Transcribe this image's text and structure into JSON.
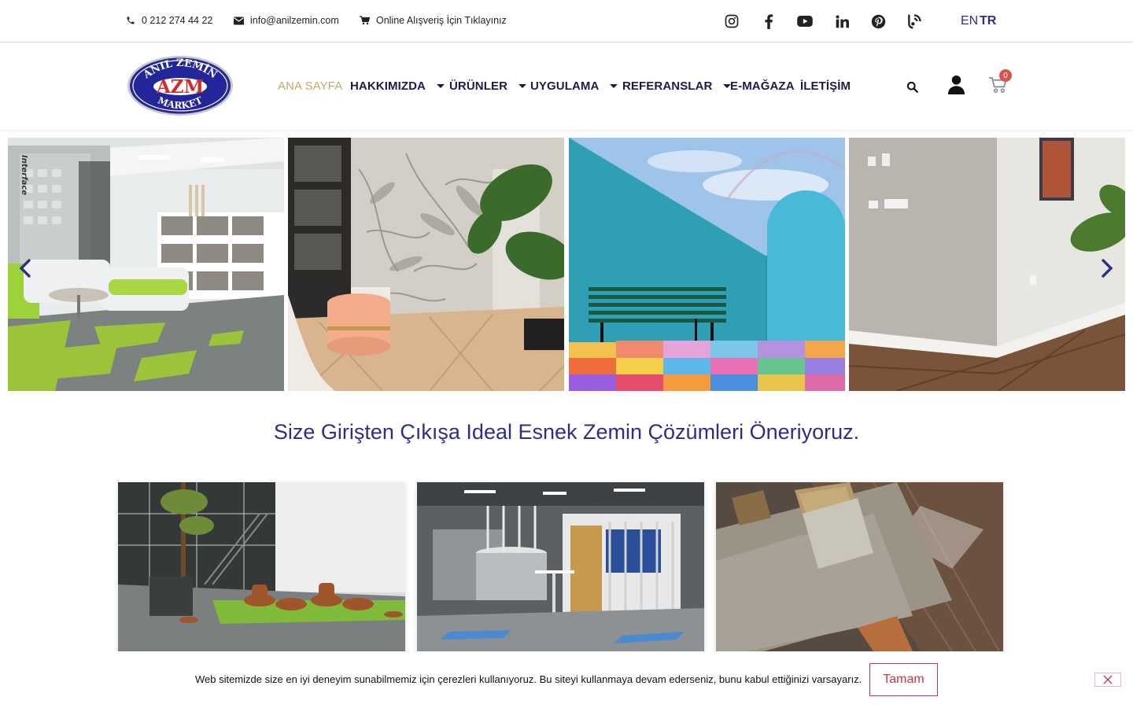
{
  "topbar": {
    "phone": "0 212 274 44 22",
    "email": "info@anilzemin.com",
    "shop": "Online Alışveriş İçin Tıklayınız",
    "social_icons": [
      "instagram-icon",
      "facebook-icon",
      "youtube-icon",
      "linkedin-icon",
      "pinterest-icon",
      "blog-icon"
    ],
    "lang_en": "EN",
    "lang_tr": "TR"
  },
  "logo": {
    "top_text": "ANIL ZEMİN",
    "mid_text": "AZM",
    "bottom_text": "MARKET"
  },
  "nav": {
    "items": [
      "ANA SAYFA",
      "HAKKIMIZDA",
      "ÜRÜNLER",
      "UYGULAMA",
      "REFERANSLAR",
      "E-MAĞAZA",
      "İLETİŞİM"
    ],
    "cart_count": "0"
  },
  "slider": {
    "slide1_brand": "Interface"
  },
  "main": {
    "headline": "Size Girişten Çıkışa Ideal Esnek Zemin Çözümleri Öneriyoruz."
  },
  "cookie": {
    "text": "Web sitemizde size en iyi deneyim sunabilmemiz için çerezleri kullanıyoruz. Bu siteyi kullanmaya devam ederseniz, bunu kabul ettiğinizi varsayarız.",
    "ok_label": "Tamam"
  },
  "colors": {
    "brand_blue": "#2e2e8a",
    "nav_dark": "#1c1c4a",
    "nav_active": "#c8a86a",
    "cookie_accent": "#c9334e"
  }
}
